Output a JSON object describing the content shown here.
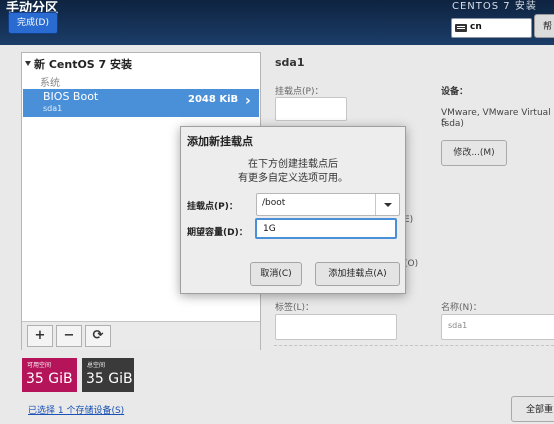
{
  "header": {
    "title": "手动分区",
    "done_label": "完成(D)",
    "product": "CENTOS 7 安装",
    "keyboard_layout": "cn",
    "help_label": "帮"
  },
  "left_panel": {
    "install_header": "新 CentOS 7 安装",
    "group_label": "系统",
    "partition": {
      "name": "BIOS Boot",
      "device": "sda1",
      "size": "2048 KiB"
    },
    "tools": {
      "add": "+",
      "remove": "−",
      "refresh": "⟳"
    }
  },
  "space": {
    "available_label": "可用空间",
    "available_value": "35 GiB",
    "total_label": "总空间",
    "total_value": "35 GiB"
  },
  "storage_link": "已选择 1 个存储设备(S)",
  "detail": {
    "title": "sda1",
    "mount_point_label": "挂载点(P)：",
    "devices_label": "设备：",
    "device_desc_line1": "VMware, VMware Virtual S",
    "device_desc_line2": "(sda)",
    "modify_label": "修改...(M)",
    "partial_e": "E)",
    "partial_o": "(O)",
    "tag_label": "标签(L)：",
    "name_label": "名称(N)：",
    "name_value": "sda1",
    "apply_label": "全部重"
  },
  "dialog": {
    "title": "添加新挂载点",
    "desc_line1": "在下方创建挂载点后",
    "desc_line2": "有更多自定义选项可用。",
    "mount_label": "挂载点(P)：",
    "mount_value": "/boot",
    "capacity_label": "期望容量(D)：",
    "capacity_value": "1G",
    "cancel_label": "取消(C)",
    "add_label": "添加挂载点(A)"
  },
  "colors": {
    "available_bg": "#b5135a",
    "total_bg": "#3a3a3a",
    "selection": "#4a90d9",
    "header_bg": "#14304f"
  }
}
